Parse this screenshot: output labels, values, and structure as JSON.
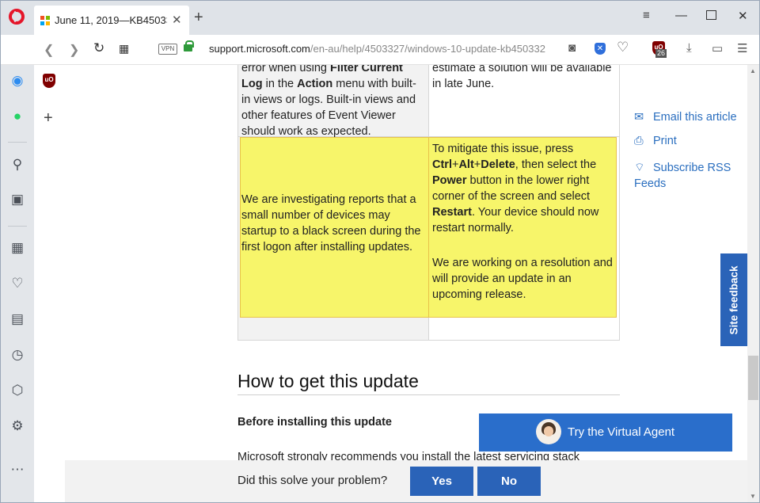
{
  "browser": {
    "tab_title": "June 11, 2019—KB4503327",
    "new_tab": "+",
    "url_host": "support.microsoft.com",
    "url_path": "/en-au/help/4503327/windows-10-update-kb450332",
    "vpn_label": "VPN",
    "ublock_count": "26"
  },
  "table": {
    "row1_left_html": "You may also receive the same error when using <b>Filter Current Log</b> in the <b>Action</b> menu with built-in views or logs. Built-in views and other features of Event Viewer should work as expected.",
    "row1_right": "We are working on a resolution and estimate a solution will be available in late June.",
    "row2_left": "We are investigating reports that a small number of devices may startup to a black screen during the first logon after installing updates.",
    "row2_right_p1_html": "To mitigate this issue, press <b>Ctrl</b>+<b>Alt</b>+<b>Delete</b>, then select the <b>Power</b> button in the lower right corner of the screen and select <b>Restart</b>. Your device should now restart normally.",
    "row2_right_p2": "We are working on a resolution and will provide an update in an upcoming release."
  },
  "section": {
    "heading": "How to get this update",
    "subheading": "Before installing this update",
    "paragraph": "Microsoft strongly recommends you install the latest servicing stack"
  },
  "right_links": {
    "email": "Email this article",
    "print": "Print",
    "rss": "Subscribe RSS Feeds"
  },
  "site_feedback": "Site feedback",
  "virtual_agent": "Try the Virtual Agent",
  "feedback": {
    "question": "Did this solve your problem?",
    "yes": "Yes",
    "no": "No"
  },
  "colors": {
    "highlight": "#f7f56a",
    "link": "#2a6ebf",
    "brand_blue": "#2a63b8"
  }
}
